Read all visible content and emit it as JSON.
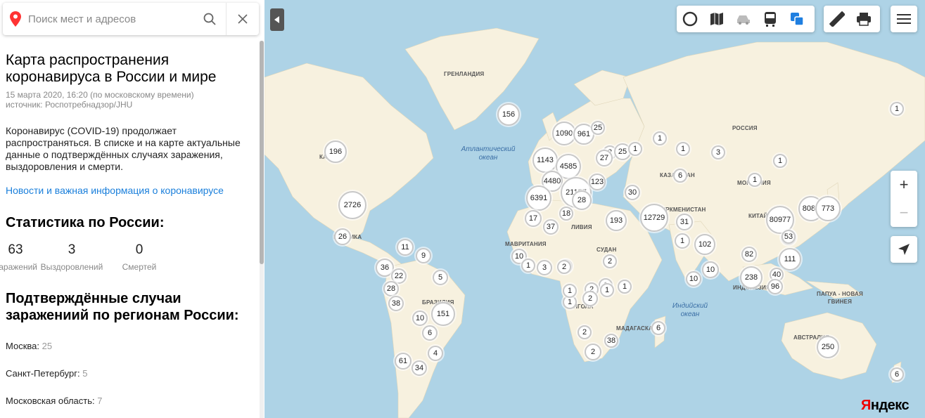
{
  "search": {
    "placeholder": "Поиск мест и адресов"
  },
  "article": {
    "title": "Карта распространения коронавируса в России и мире",
    "date": "15 марта 2020, 16:20 (по московскому времени)",
    "source": "источник: Роспотребнадзор/JHU",
    "description": "Коронавирус (COVID-19) продолжает распространяться. В списке и на карте актуальные данные о подтверждённых случаях заражения, выздоровления и смерти.",
    "news_link": "Новости и важная информация о коронавирусе"
  },
  "russia_stats": {
    "heading": "Статистика по России:",
    "items": [
      {
        "value": "63",
        "label": "Заражений"
      },
      {
        "value": "3",
        "label": "Выздоровлений"
      },
      {
        "value": "0",
        "label": "Смертей"
      }
    ]
  },
  "regions": {
    "heading": "Подтверждённые случаи заражениий по регионам России:",
    "items": [
      {
        "name": "Москва:",
        "count": "25"
      },
      {
        "name": "Санкт-Петербург:",
        "count": "5"
      },
      {
        "name": "Московская область:",
        "count": "7"
      }
    ]
  },
  "map": {
    "labels": {
      "greenland": "ГРЕНЛАНДИЯ",
      "russia": "РОССИЯ",
      "kazakhstan": "КАЗАХСТАН",
      "mongolia": "МОНГОЛИЯ",
      "china": "КИТАЙ",
      "libya": "ЛИВИЯ",
      "mauritania": "МАВРИТАНИЯ",
      "sudan": "СУДАН",
      "angola": "АНГОЛА",
      "madagascar": "МАДАГАСКАР",
      "brazil": "БРАЗИЛИЯ",
      "papua": "ПАПУА - НОВАЯ ГВИНЕЯ",
      "australia": "АВСТРАЛИЯ",
      "turkmenistan": "ТУРКМЕНИСТАН",
      "mexico": "МЕКСИКА",
      "indonesia": "ИНДОНЕЗИЯ",
      "canada": "КАНАДА"
    },
    "oceans": {
      "atlantic": "Атлантический океан",
      "indian": "Индийский океан"
    },
    "clusters": [
      "156",
      "1090",
      "961",
      "25",
      "1143",
      "4585",
      "4480",
      "21157",
      "6391",
      "1",
      "2",
      "2",
      "1",
      "196",
      "2726",
      "26",
      "11",
      "36",
      "22",
      "28",
      "38",
      "10",
      "151",
      "6",
      "4",
      "61",
      "34",
      "9",
      "5",
      "1",
      "25",
      "1",
      "27",
      "123",
      "30",
      "193",
      "12729",
      "31",
      "1",
      "3",
      "102",
      "10",
      "10",
      "82",
      "53",
      "111",
      "8086",
      "773",
      "80977",
      "53",
      "238",
      "40",
      "96",
      "1",
      "1",
      "6",
      "1",
      "6",
      "2",
      "2",
      "38",
      "1",
      "1",
      "1",
      "2",
      "1",
      "17",
      "37",
      "18",
      "10",
      "1",
      "3",
      "2",
      "250",
      "6",
      "2",
      "1",
      "28"
    ],
    "zoom_in": "+",
    "zoom_out": "−",
    "brand_main": "Я",
    "brand_rest": "ндекс"
  },
  "colors": {
    "link": "#1a7fdb",
    "water": "#aed3e6",
    "land": "#f7f1df",
    "brand": "#ee0000",
    "pin": "#ff3333"
  }
}
